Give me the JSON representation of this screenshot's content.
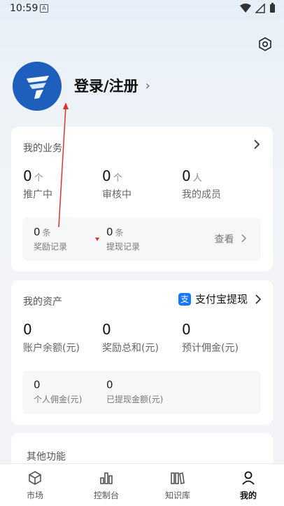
{
  "status": {
    "time": "10:59",
    "notification_glyph": "A"
  },
  "profile": {
    "login_label": "登录/注册",
    "chevron": "›"
  },
  "business": {
    "title": "我的业务",
    "stats": [
      {
        "value": "0",
        "unit": "个",
        "label": "推广中"
      },
      {
        "value": "0",
        "unit": "个",
        "label": "审核中"
      },
      {
        "value": "0",
        "unit": "人",
        "label": "我的成员"
      }
    ],
    "sub": [
      {
        "value": "0",
        "unit": "条",
        "label": "奖励记录"
      },
      {
        "value": "0",
        "unit": "条",
        "label": "提现记录"
      }
    ],
    "view_label": "查看"
  },
  "assets": {
    "title": "我的资产",
    "alipay_icon_glyph": "支",
    "alipay_label": "支付宝提现",
    "stats": [
      {
        "value": "0",
        "label": "账户余额(元)"
      },
      {
        "value": "0",
        "label": "奖励总和(元)"
      },
      {
        "value": "0",
        "label": "预计佣金(元)"
      }
    ],
    "sub": [
      {
        "value": "0",
        "label": "个人佣金(元)"
      },
      {
        "value": "0",
        "label": "已提现金额(元)"
      }
    ]
  },
  "other": {
    "title": "其他功能"
  },
  "tabs": [
    {
      "label": "市场",
      "icon": "cube-icon",
      "active": false
    },
    {
      "label": "控制台",
      "icon": "bar-chart-icon",
      "active": false
    },
    {
      "label": "知识库",
      "icon": "books-icon",
      "active": false
    },
    {
      "label": "我的",
      "icon": "person-icon",
      "active": true
    }
  ],
  "colors": {
    "accent": "#1e5fbd",
    "alipay": "#1677ff",
    "annotation": "#d9342b"
  }
}
